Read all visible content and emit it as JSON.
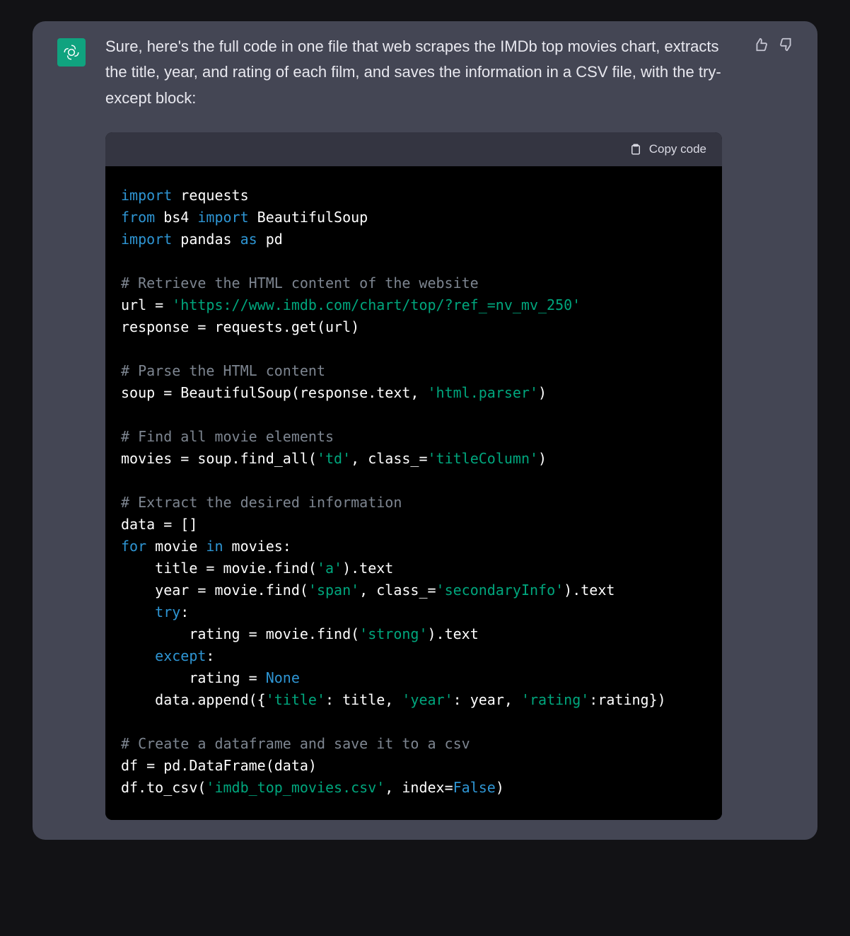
{
  "message": {
    "intro": "Sure, here's the full code in one file that web scrapes the IMDb top movies chart, extracts the title, year, and rating of each film, and saves the information in a CSV file, with the try-except block:"
  },
  "feedback": {
    "like_label": "thumbs up",
    "dislike_label": "thumbs down"
  },
  "codeblock": {
    "copy_label": "Copy code",
    "tokens": [
      {
        "c": "kw",
        "t": "import"
      },
      {
        "c": "pl",
        "t": " requests\n"
      },
      {
        "c": "kw",
        "t": "from"
      },
      {
        "c": "pl",
        "t": " bs4 "
      },
      {
        "c": "kw",
        "t": "import"
      },
      {
        "c": "pl",
        "t": " BeautifulSoup\n"
      },
      {
        "c": "kw",
        "t": "import"
      },
      {
        "c": "pl",
        "t": " pandas "
      },
      {
        "c": "kw",
        "t": "as"
      },
      {
        "c": "pl",
        "t": " pd\n"
      },
      {
        "c": "pl",
        "t": "\n"
      },
      {
        "c": "cm",
        "t": "# Retrieve the HTML content of the website"
      },
      {
        "c": "pl",
        "t": "\n"
      },
      {
        "c": "pl",
        "t": "url = "
      },
      {
        "c": "str",
        "t": "'https://www.imdb.com/chart/top/?ref_=nv_mv_250'"
      },
      {
        "c": "pl",
        "t": "\n"
      },
      {
        "c": "pl",
        "t": "response = requests.get(url)\n"
      },
      {
        "c": "pl",
        "t": "\n"
      },
      {
        "c": "cm",
        "t": "# Parse the HTML content"
      },
      {
        "c": "pl",
        "t": "\n"
      },
      {
        "c": "pl",
        "t": "soup = BeautifulSoup(response.text, "
      },
      {
        "c": "str",
        "t": "'html.parser'"
      },
      {
        "c": "pl",
        "t": ")\n"
      },
      {
        "c": "pl",
        "t": "\n"
      },
      {
        "c": "cm",
        "t": "# Find all movie elements"
      },
      {
        "c": "pl",
        "t": "\n"
      },
      {
        "c": "pl",
        "t": "movies = soup.find_all("
      },
      {
        "c": "str",
        "t": "'td'"
      },
      {
        "c": "pl",
        "t": ", class_="
      },
      {
        "c": "str",
        "t": "'titleColumn'"
      },
      {
        "c": "pl",
        "t": ")\n"
      },
      {
        "c": "pl",
        "t": "\n"
      },
      {
        "c": "cm",
        "t": "# Extract the desired information"
      },
      {
        "c": "pl",
        "t": "\n"
      },
      {
        "c": "pl",
        "t": "data = []\n"
      },
      {
        "c": "kw",
        "t": "for"
      },
      {
        "c": "pl",
        "t": " movie "
      },
      {
        "c": "kw",
        "t": "in"
      },
      {
        "c": "pl",
        "t": " movies:\n"
      },
      {
        "c": "pl",
        "t": "    title = movie.find("
      },
      {
        "c": "str",
        "t": "'a'"
      },
      {
        "c": "pl",
        "t": ").text\n"
      },
      {
        "c": "pl",
        "t": "    year = movie.find("
      },
      {
        "c": "str",
        "t": "'span'"
      },
      {
        "c": "pl",
        "t": ", class_="
      },
      {
        "c": "str",
        "t": "'secondaryInfo'"
      },
      {
        "c": "pl",
        "t": ").text\n"
      },
      {
        "c": "pl",
        "t": "    "
      },
      {
        "c": "kw",
        "t": "try"
      },
      {
        "c": "pl",
        "t": ":\n"
      },
      {
        "c": "pl",
        "t": "        rating = movie.find("
      },
      {
        "c": "str",
        "t": "'strong'"
      },
      {
        "c": "pl",
        "t": ").text\n"
      },
      {
        "c": "pl",
        "t": "    "
      },
      {
        "c": "kw",
        "t": "except"
      },
      {
        "c": "pl",
        "t": ":\n"
      },
      {
        "c": "pl",
        "t": "        rating = "
      },
      {
        "c": "kw",
        "t": "None"
      },
      {
        "c": "pl",
        "t": "\n"
      },
      {
        "c": "pl",
        "t": "    data.append({"
      },
      {
        "c": "str",
        "t": "'title'"
      },
      {
        "c": "pl",
        "t": ": title, "
      },
      {
        "c": "str",
        "t": "'year'"
      },
      {
        "c": "pl",
        "t": ": year, "
      },
      {
        "c": "str",
        "t": "'rating'"
      },
      {
        "c": "pl",
        "t": ":rating})\n"
      },
      {
        "c": "pl",
        "t": "\n"
      },
      {
        "c": "cm",
        "t": "# Create a dataframe and save it to a csv"
      },
      {
        "c": "pl",
        "t": "\n"
      },
      {
        "c": "pl",
        "t": "df = pd.DataFrame(data)\n"
      },
      {
        "c": "pl",
        "t": "df.to_csv("
      },
      {
        "c": "str",
        "t": "'imdb_top_movies.csv'"
      },
      {
        "c": "pl",
        "t": ", index="
      },
      {
        "c": "kw",
        "t": "False"
      },
      {
        "c": "pl",
        "t": ")\n"
      }
    ]
  }
}
